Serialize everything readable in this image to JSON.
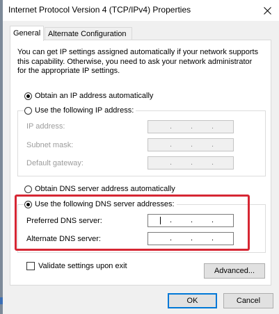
{
  "window": {
    "title": "Internet Protocol Version 4 (TCP/IPv4) Properties"
  },
  "tabs": [
    {
      "label": "General",
      "active": true
    },
    {
      "label": "Alternate Configuration",
      "active": false
    }
  ],
  "description": "You can get IP settings assigned automatically if your network supports this capability. Otherwise, you need to ask your network administrator for the appropriate IP settings.",
  "ip_section": {
    "auto_label": "Obtain an IP address automatically",
    "manual_label": "Use the following IP address:",
    "selected": "auto",
    "fields": [
      {
        "label": "IP address:",
        "value": ". . ."
      },
      {
        "label": "Subnet mask:",
        "value": ". . ."
      },
      {
        "label": "Default gateway:",
        "value": ". . ."
      }
    ]
  },
  "dns_section": {
    "auto_label": "Obtain DNS server address automatically",
    "manual_label": "Use the following DNS server addresses:",
    "selected": "manual",
    "fields": [
      {
        "label": "Preferred DNS server:",
        "value": ". . .",
        "focused": true
      },
      {
        "label": "Alternate DNS server:",
        "value": ". . .",
        "focused": false
      }
    ]
  },
  "validate": {
    "label": "Validate settings upon exit",
    "checked": false
  },
  "buttons": {
    "advanced": "Advanced...",
    "ok": "OK",
    "cancel": "Cancel"
  },
  "colors": {
    "highlight": "#d62633",
    "focus_border": "#0078d7"
  }
}
